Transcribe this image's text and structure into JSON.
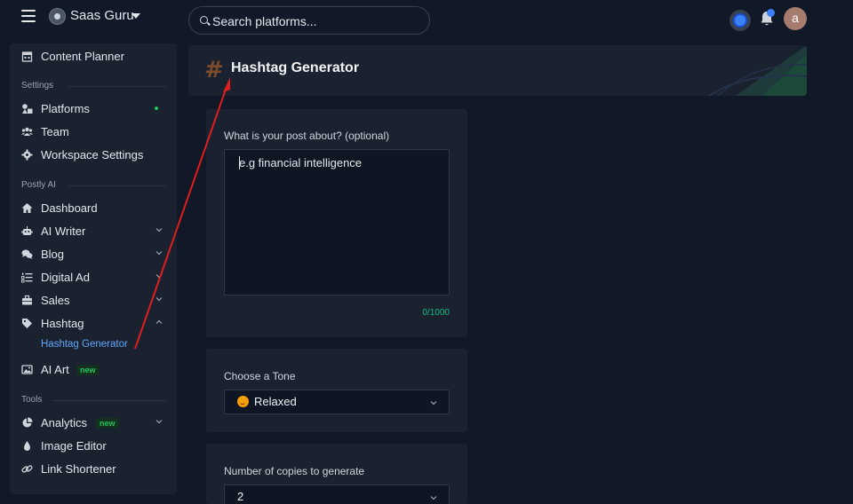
{
  "topbar": {
    "workspace_name": "Saas Guru",
    "search_placeholder": "Search platforms...",
    "avatar_initial": "a"
  },
  "sidebar": {
    "content_planner": "Content Planner",
    "section_settings": "Settings",
    "platforms": "Platforms",
    "team": "Team",
    "workspace_settings": "Workspace Settings",
    "section_postly_ai": "Postly AI",
    "dashboard": "Dashboard",
    "ai_writer": "AI Writer",
    "blog": "Blog",
    "digital_ad": "Digital Ad",
    "sales": "Sales",
    "hashtag": "Hashtag",
    "hashtag_generator": "Hashtag Generator",
    "ai_art": "AI Art",
    "new_badge": "new",
    "section_tools": "Tools",
    "analytics": "Analytics",
    "image_editor": "Image Editor",
    "link_shortener": "Link Shortener"
  },
  "header": {
    "title": "Hashtag Generator",
    "hash_glyph": "#"
  },
  "form": {
    "post_about_label": "What is your post about? (optional)",
    "post_about_placeholder": "e.g financial intelligence",
    "counter": "0/1000",
    "tone_label": "Choose a Tone",
    "tone_value": "Relaxed",
    "copies_label": "Number of copies to generate",
    "copies_value": "2"
  },
  "colors": {
    "accent": "#3b82f6",
    "active_link": "#60a5fa",
    "success": "#22c55e",
    "annotation_arrow": "#e11d1d"
  }
}
